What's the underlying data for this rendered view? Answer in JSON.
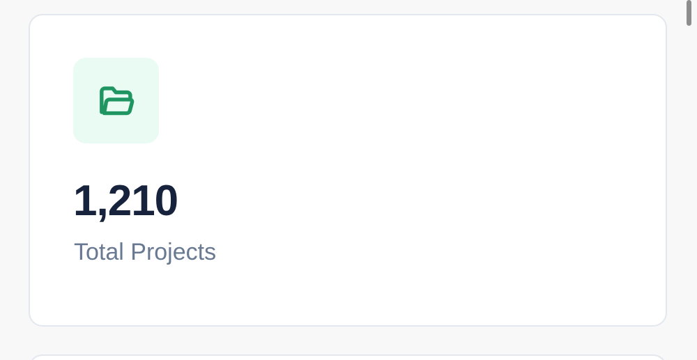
{
  "stat_card": {
    "value": "1,210",
    "label": "Total Projects",
    "icon": "folder-open-icon",
    "accent_color": "#1f9661",
    "icon_background_color": "#e9fbf2"
  },
  "colors": {
    "page_background": "#f8f8f8",
    "card_background": "#ffffff",
    "card_border": "#e3e7ee",
    "value_text": "#17233c",
    "label_text": "#687991",
    "scrollbar": "#8d8d8d"
  }
}
